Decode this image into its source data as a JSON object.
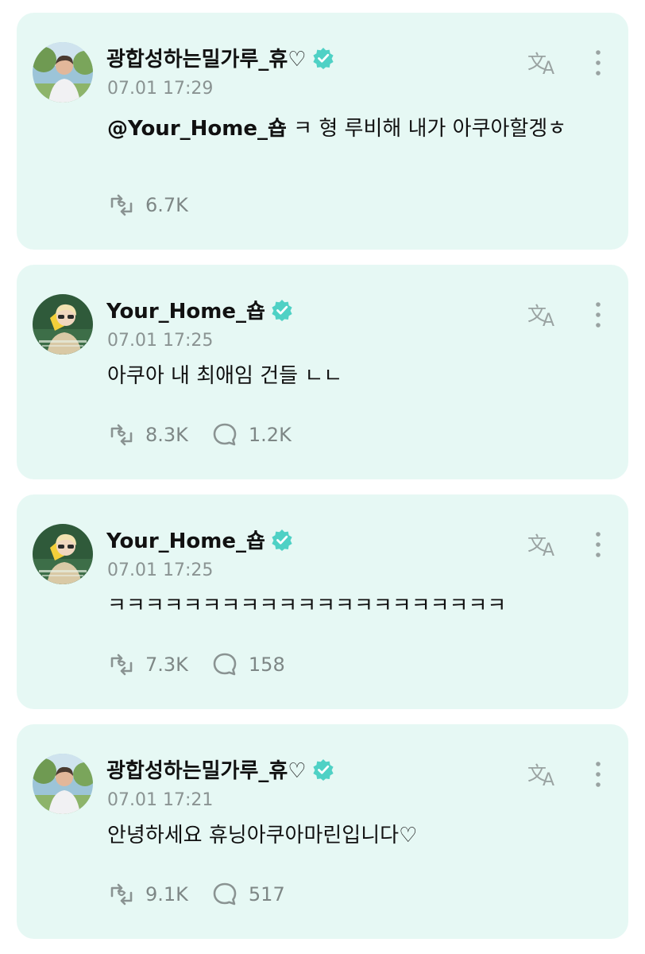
{
  "posts": [
    {
      "username": "광합성하는밀가루_휴♡",
      "time": "07.01 17:29",
      "mention": "@Your_Home_숍",
      "text": " ㅋ 형 루비해 내가 아쿠아할겡ㅎ",
      "reposts": "6.7K",
      "avatar": "avatar-outdoor"
    },
    {
      "username": "Your_Home_숍",
      "time": "07.01 17:25",
      "text": "아쿠아 내 최애임 건들 ㄴㄴ",
      "reposts": "8.3K",
      "comments": "1.2K",
      "avatar": "avatar-sunglasses"
    },
    {
      "username": "Your_Home_숍",
      "time": "07.01 17:25",
      "text": "ㅋㅋㅋㅋㅋㅋㅋㅋㅋㅋㅋㅋㅋㅋㅋㅋㅋㅋㅋㅋㅋ",
      "reposts": "7.3K",
      "comments": "158",
      "avatar": "avatar-sunglasses"
    },
    {
      "username": "광합성하는밀가루_휴♡",
      "time": "07.01 17:21",
      "text": "안녕하세요 휴닝아쿠아마린입니다♡",
      "reposts": "9.1K",
      "comments": "517",
      "avatar": "avatar-outdoor"
    }
  ],
  "colors": {
    "card_bg": "#e6f8f4",
    "verified": "#4fd1c5",
    "muted": "#7e8786"
  },
  "icons": [
    "verified-badge-icon",
    "translate-icon",
    "more-vertical-icon",
    "repost-icon",
    "comment-icon"
  ]
}
